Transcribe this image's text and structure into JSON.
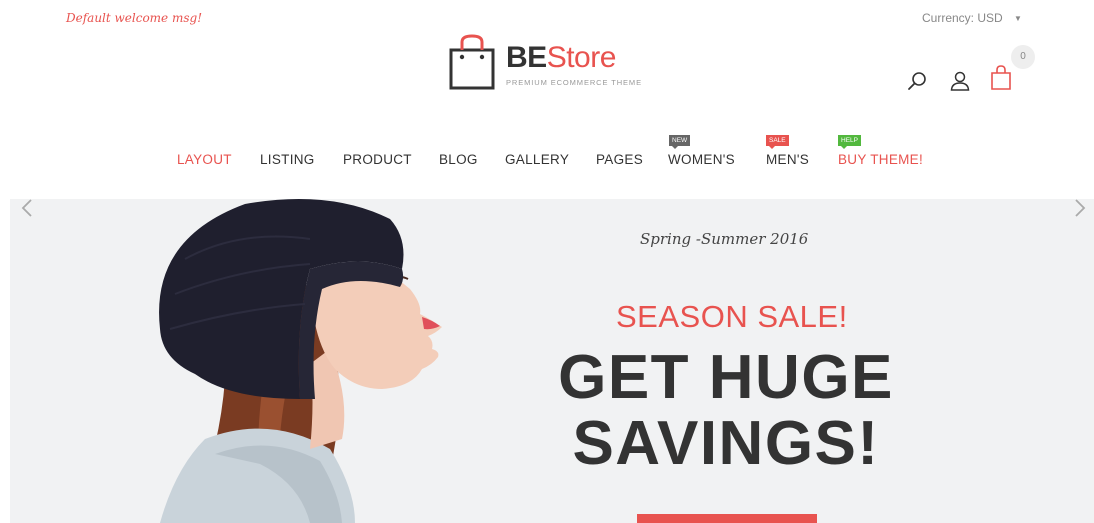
{
  "topbar": {
    "welcome": "Default welcome msg!",
    "currency_label": "Currency:",
    "currency_value": "USD"
  },
  "logo": {
    "brand_bold": "BE",
    "brand_light": "Store",
    "tagline": "PREMIUM ECOMMERCE THEME"
  },
  "header_tools": {
    "icons": [
      "search-icon",
      "user-icon",
      "cart-icon"
    ],
    "cart_count": "0"
  },
  "nav": {
    "items": [
      {
        "label": "LAYOUT",
        "active": true
      },
      {
        "label": "LISTING"
      },
      {
        "label": "PRODUCT"
      },
      {
        "label": "BLOG"
      },
      {
        "label": "GALLERY"
      },
      {
        "label": "PAGES"
      },
      {
        "label": "WOMEN'S",
        "badge": "NEW"
      },
      {
        "label": "MEN'S",
        "badge": "SALE"
      },
      {
        "label": "BUY THEME!",
        "badge": "HELP"
      }
    ]
  },
  "hero": {
    "kicker": "Spring -Summer 2016",
    "subtitle": "SEASON SALE!",
    "title_line1": "GET HUGE",
    "title_line2": "SAVINGS!",
    "prev_icon": "chevron-left-icon",
    "next_icon": "chevron-right-icon"
  },
  "colors": {
    "accent": "#e8534f",
    "text_dark": "#333333",
    "badge_new": "#666666",
    "badge_help": "#52b83e",
    "hero_bg": "#f1f2f3"
  }
}
